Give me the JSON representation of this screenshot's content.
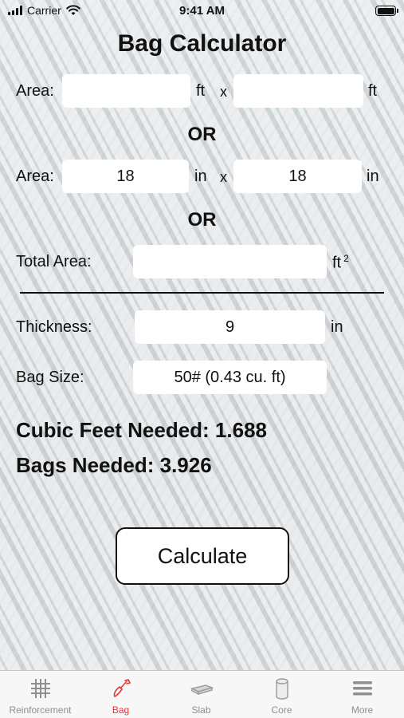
{
  "status_bar": {
    "carrier": "Carrier",
    "time": "9:41 AM"
  },
  "title": "Bag Calculator",
  "row1": {
    "label": "Area:",
    "value1": "",
    "unit1": "ft",
    "times": "x",
    "value2": "",
    "unit2": "ft"
  },
  "or1": "OR",
  "row2": {
    "label": "Area:",
    "value1": "18",
    "unit1": "in",
    "times": "x",
    "value2": "18",
    "unit2": "in"
  },
  "or2": "OR",
  "total_area": {
    "label": "Total Area:",
    "value": "",
    "unit": "ft",
    "unit_sup": "2"
  },
  "thickness": {
    "label": "Thickness:",
    "value": "9",
    "unit": "in"
  },
  "bag_size": {
    "label": "Bag Size:",
    "value": "50# (0.43 cu. ft)"
  },
  "results": {
    "cubic_feet": "Cubic Feet Needed: 1.688",
    "bags": "Bags Needed: 3.926"
  },
  "calculate_label": "Calculate",
  "tabs": [
    {
      "label": "Reinforcement",
      "icon": "grid-icon",
      "active": false
    },
    {
      "label": "Bag",
      "icon": "trowel-icon",
      "active": true
    },
    {
      "label": "Slab",
      "icon": "slab-icon",
      "active": false
    },
    {
      "label": "Core",
      "icon": "cylinder-icon",
      "active": false
    },
    {
      "label": "More",
      "icon": "menu-icon",
      "active": false
    }
  ],
  "colors": {
    "active_tab": "#e0393e",
    "inactive_tab": "#8e8e93"
  }
}
